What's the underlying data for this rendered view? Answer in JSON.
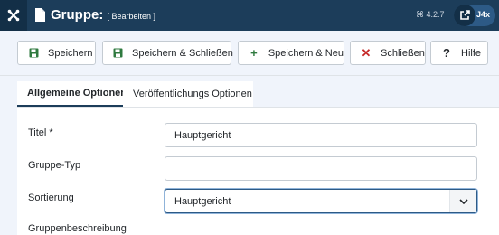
{
  "header": {
    "title": "Gruppe:",
    "title_suffix": "[ Bearbeiten ]",
    "version": "⌘ 4.2.7",
    "badge_label": "J4x",
    "colors": {
      "bg": "#1c3d5a",
      "accent": "#2d5a86"
    }
  },
  "toolbar": {
    "save": "Speichern",
    "save_close": "Speichern & Schließen",
    "save_new": "Speichern & Neu",
    "close": "Schließen",
    "help": "Hilfe"
  },
  "tabs": [
    {
      "label": "Allgemeine Optionen",
      "active": true
    },
    {
      "label": "Veröffentlichungs Optionen",
      "active": false
    }
  ],
  "form": {
    "title_label": "Titel *",
    "title_value": "Hauptgericht",
    "group_type_label": "Gruppe-Typ",
    "group_type_value": "",
    "ordering_label": "Sortierung",
    "ordering_value": "Hauptgericht",
    "description_label": "Gruppenbeschreibung"
  },
  "icons": {
    "logo": "joomla-logo-icon",
    "page": "file-icon",
    "external": "external-link-icon",
    "save": "floppy-disk-icon",
    "plus": "plus-icon",
    "close": "times-icon",
    "help": "question-icon",
    "chevron": "chevron-down-icon"
  }
}
